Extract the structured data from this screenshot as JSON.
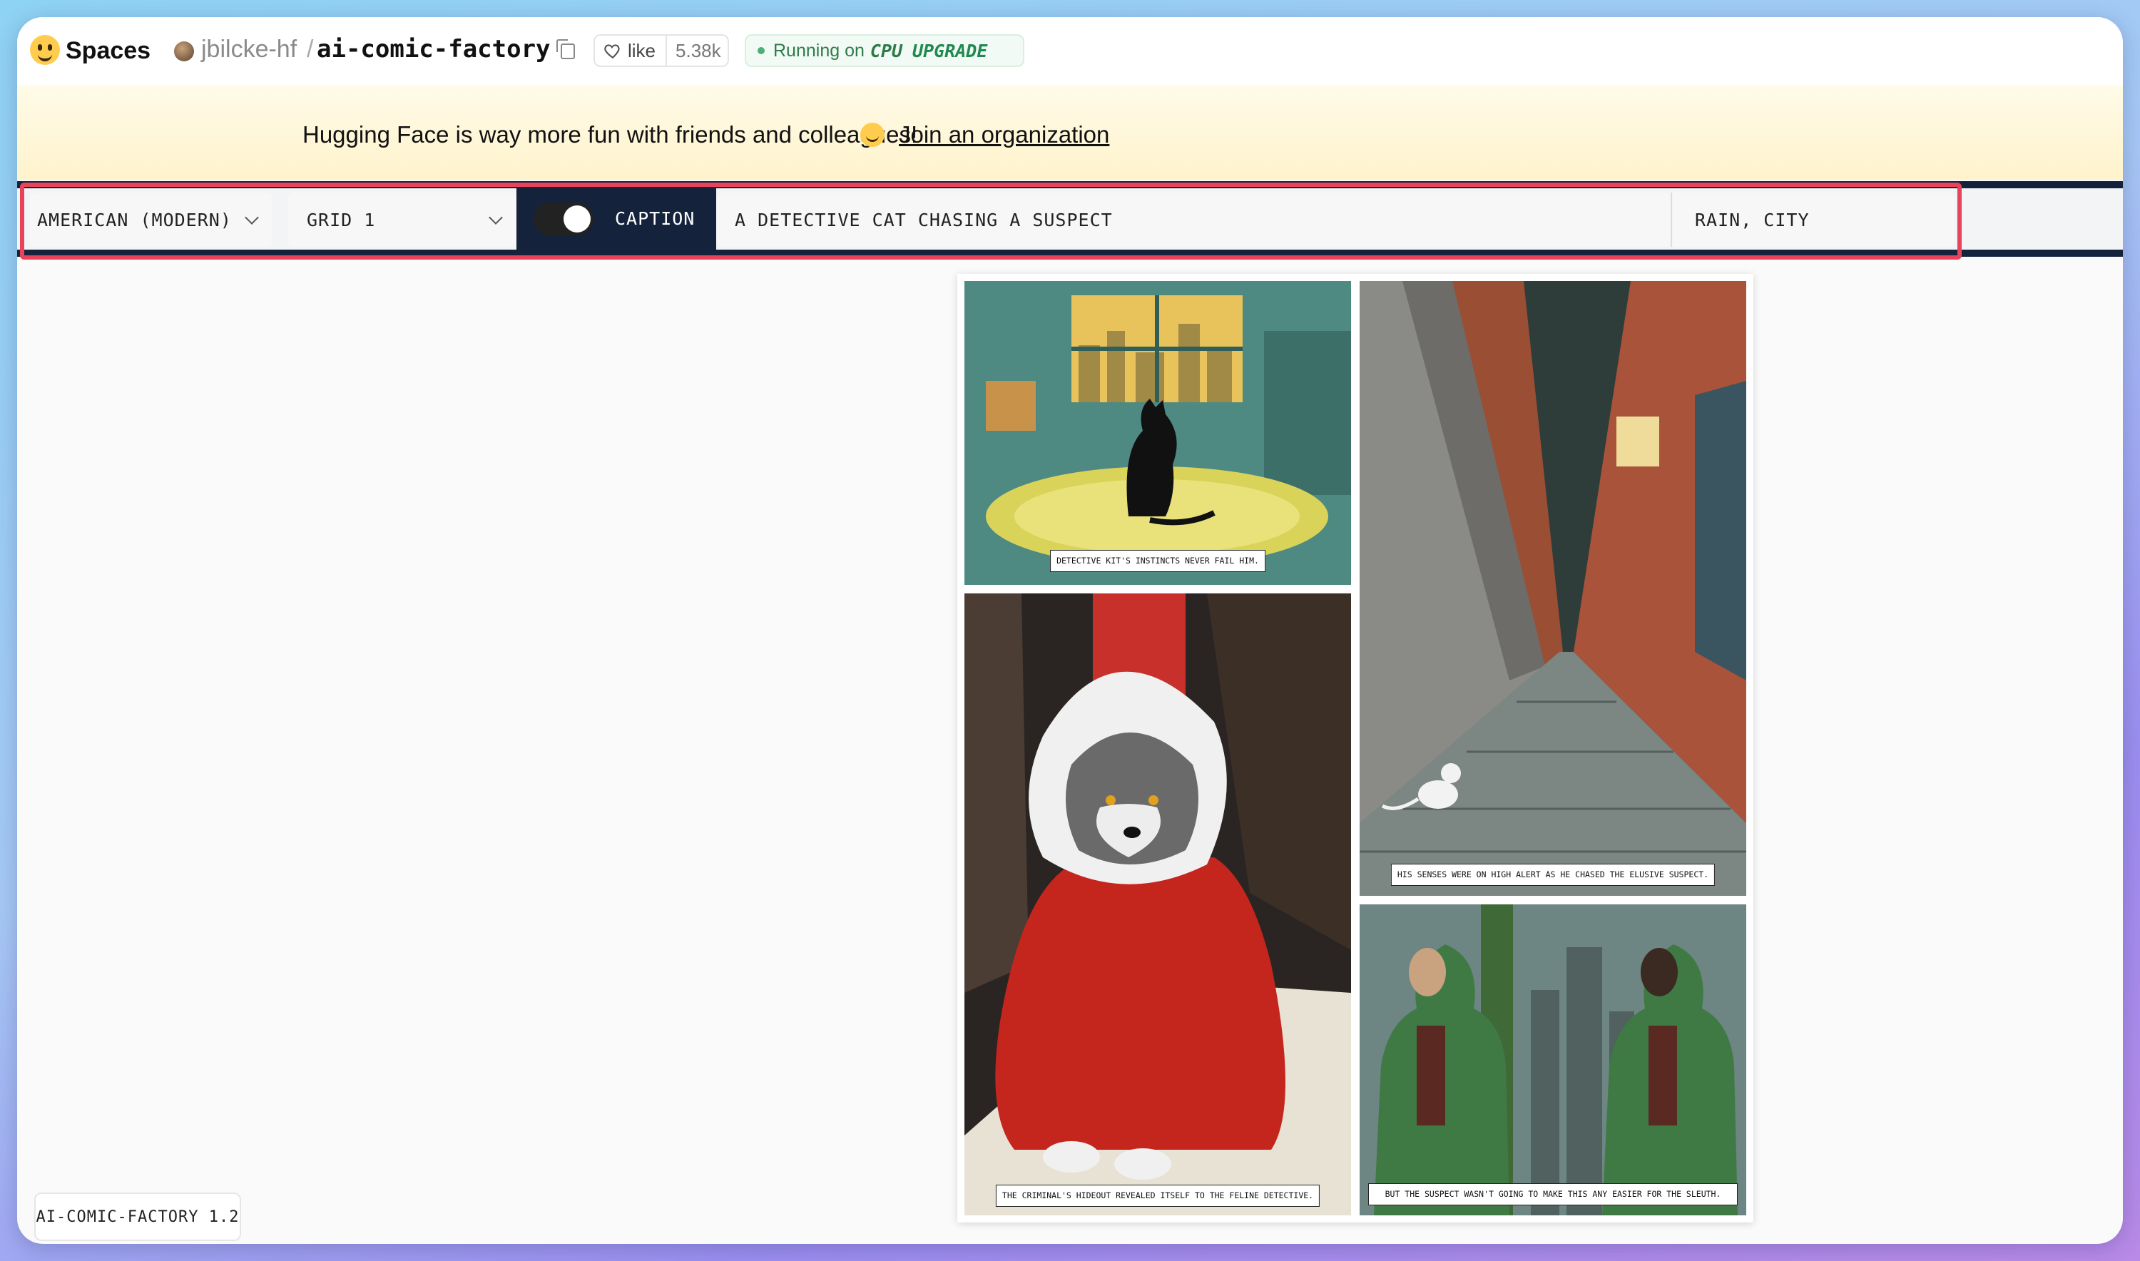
{
  "header": {
    "brand_label": "Spaces",
    "owner": "jbilcke-hf",
    "separator": "/",
    "repo": "ai-comic-factory",
    "like_label": "like",
    "like_count": "5.38k",
    "status_prefix": "Running on",
    "status_hardware": "CPU",
    "status_upgrade": "UPGRADE",
    "icons": [
      "hugging-face-logo-icon",
      "user-avatar",
      "copy-icon",
      "heart-icon",
      "status-dot-icon"
    ]
  },
  "banner": {
    "text": "Hugging Face is way more fun with friends and colleagues!",
    "link": "Join an organization",
    "icon": "hugging-face-emoji-icon",
    "color": "#fff6d6"
  },
  "toolbar": {
    "style_value": "American (modern)",
    "layout_value": "Grid 1",
    "caption_label": "Caption",
    "caption_enabled": true,
    "prompt_value": "A detective cat chasing a suspect",
    "tags_value": "Rain, city",
    "accent_color": "#14223c",
    "highlight_color": "#e8435a"
  },
  "comic": {
    "panels": [
      {
        "caption": "Detective Kit's instincts never fail him."
      },
      {
        "caption": "His senses were on high alert as he chased the elusive suspect."
      },
      {
        "caption": "The criminal's hideout revealed itself to the feline detective."
      },
      {
        "caption": "But the suspect wasn't going to make this any easier for the sleuth."
      }
    ]
  },
  "footer": {
    "version": "AI-COMIC-FACTORY 1.2"
  }
}
